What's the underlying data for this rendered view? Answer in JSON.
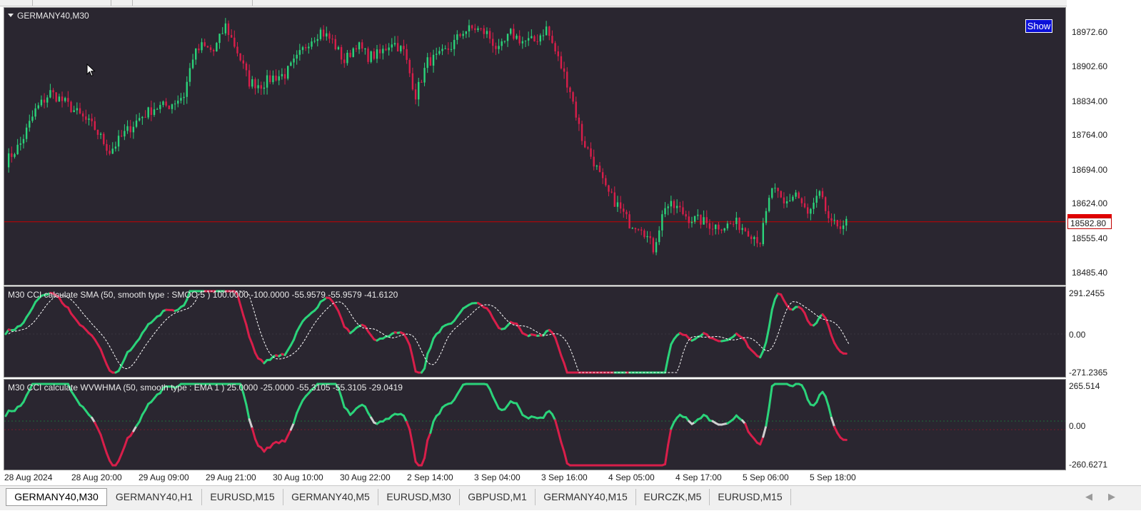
{
  "chart": {
    "symbol_title": "GERMANY40,M30",
    "show_button": "Show",
    "price_labels": [
      "18972.60",
      "18902.60",
      "18834.00",
      "18764.00",
      "18694.00",
      "18624.00",
      "18555.40",
      "18485.40"
    ],
    "current_price": "18582.80",
    "price_line": 18582.8
  },
  "indicator1": {
    "title": "M30 CCI calculate  SMA (50, smooth type :  SMOO  5 ) 100.0000 -100.0000 -55.9579 -55.9579 -41.6120",
    "scale_labels": [
      "291.2455",
      "0.00",
      "-271.2365"
    ]
  },
  "indicator2": {
    "title": "M30 CCI calculate WVWHMA (50, smooth type : EMA  1 ) 25.0000 -25.0000 -55.3105 -55.3105 -29.0419",
    "scale_labels": [
      "265.514",
      "0.00",
      "-260.6271"
    ]
  },
  "time_labels": [
    "28 Aug 2024",
    "28 Aug 20:00",
    "29 Aug 09:00",
    "29 Aug 21:00",
    "30 Aug 10:00",
    "30 Aug 22:00",
    "2 Sep 14:00",
    "3 Sep 04:00",
    "3 Sep 16:00",
    "4 Sep 05:00",
    "4 Sep 17:00",
    "5 Sep 06:00",
    "5 Sep 18:00"
  ],
  "tabs": [
    "GERMANY40,M30",
    "GERMANY40,H1",
    "EURUSD,M15",
    "GERMANY40,M5",
    "EURUSD,M30",
    "GBPUSD,M1",
    "GERMANY40,M15",
    "EURCZK,M5",
    "EURUSD,M15"
  ],
  "active_tab": 0,
  "colors": {
    "bg": "#2a2630",
    "bull": "#2bd37a",
    "bear": "#d81e4a",
    "price_line": "#c80000",
    "neutral": "#d0d0d0",
    "signal": "#ffffff"
  },
  "chart_data": {
    "type": "candlestick",
    "ylim": [
      18460,
      19000
    ],
    "price_path": [
      [
        0,
        18700
      ],
      [
        5,
        18735
      ],
      [
        10,
        18800
      ],
      [
        15,
        18835
      ],
      [
        20,
        18815
      ],
      [
        25,
        18790
      ],
      [
        30,
        18765
      ],
      [
        35,
        18720
      ],
      [
        40,
        18755
      ],
      [
        45,
        18785
      ],
      [
        50,
        18805
      ],
      [
        55,
        18810
      ],
      [
        60,
        18830
      ],
      [
        63,
        18905
      ],
      [
        66,
        18925
      ],
      [
        70,
        18915
      ],
      [
        74,
        18965
      ],
      [
        78,
        18915
      ],
      [
        82,
        18855
      ],
      [
        86,
        18850
      ],
      [
        90,
        18865
      ],
      [
        94,
        18870
      ],
      [
        98,
        18900
      ],
      [
        102,
        18935
      ],
      [
        106,
        18955
      ],
      [
        110,
        18935
      ],
      [
        114,
        18895
      ],
      [
        118,
        18930
      ],
      [
        122,
        18905
      ],
      [
        126,
        18910
      ],
      [
        130,
        18935
      ],
      [
        134,
        18915
      ],
      [
        138,
        18830
      ],
      [
        142,
        18895
      ],
      [
        146,
        18905
      ],
      [
        150,
        18925
      ],
      [
        154,
        18955
      ],
      [
        158,
        18960
      ],
      [
        162,
        18950
      ],
      [
        166,
        18915
      ],
      [
        170,
        18950
      ],
      [
        174,
        18935
      ],
      [
        178,
        18935
      ],
      [
        182,
        18960
      ],
      [
        186,
        18900
      ],
      [
        190,
        18840
      ],
      [
        194,
        18745
      ],
      [
        198,
        18700
      ],
      [
        202,
        18645
      ],
      [
        206,
        18615
      ],
      [
        210,
        18580
      ],
      [
        214,
        18575
      ],
      [
        218,
        18530
      ],
      [
        222,
        18615
      ],
      [
        226,
        18610
      ],
      [
        230,
        18590
      ],
      [
        234,
        18585
      ],
      [
        238,
        18575
      ],
      [
        242,
        18575
      ],
      [
        246,
        18580
      ],
      [
        250,
        18565
      ],
      [
        254,
        18545
      ],
      [
        258,
        18650
      ],
      [
        262,
        18615
      ],
      [
        266,
        18640
      ],
      [
        270,
        18595
      ],
      [
        274,
        18635
      ],
      [
        278,
        18575
      ],
      [
        283,
        18580
      ]
    ]
  }
}
